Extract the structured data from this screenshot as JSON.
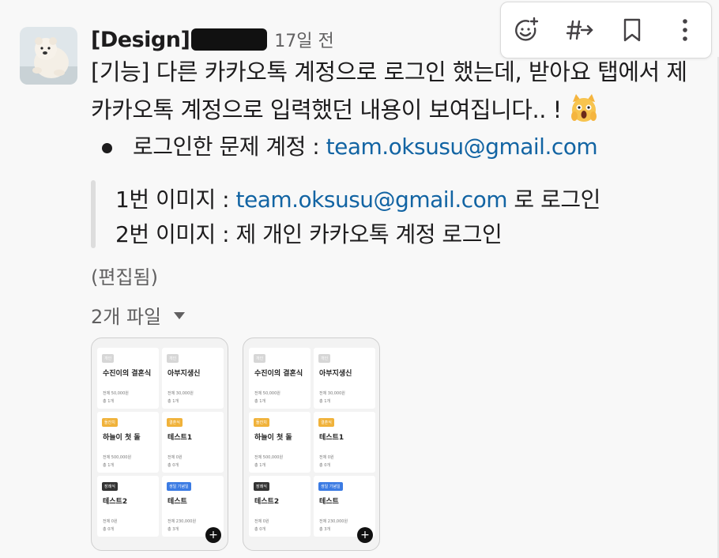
{
  "message": {
    "sender": "[Design]",
    "time": "17일 전",
    "line1": "[기능] 다른 카카오톡 계정으로 로그인 했는데, 받아요 탭에서 제",
    "line2": "카카오톡 계정으로 입력했던 내용이 보여집니다.. !",
    "bullet_label": "로그인한 문제 계정 : ",
    "bullet_email": "team.oksusu@gmail.com",
    "quote1_prefix": "1번 이미지 : ",
    "quote1_email": "team.oksusu@gmail.com",
    "quote1_suffix": " 로 로그인",
    "quote2": "2번 이미지 : 제 개인 카카오톡 계정 로그인",
    "edited": "(편집됨)",
    "files_label": "2개 파일"
  },
  "toolbar": {
    "icons": [
      "add-reaction-icon",
      "reply-in-thread-icon",
      "bookmark-icon",
      "more-options-icon"
    ]
  },
  "thumbnails": [
    {
      "cards": [
        {
          "tag": "개인",
          "tag_color": "#d6d6d6",
          "title": "수진이의 결혼식",
          "meta1": "전체 50,000원",
          "meta2": "총 1개"
        },
        {
          "tag": "개인",
          "tag_color": "#d6d6d6",
          "title": "아부지생신",
          "meta1": "전체 30,000원",
          "meta2": "총 1개"
        },
        {
          "tag": "돌잔치",
          "tag_color": "#f0b23a",
          "title": "하늘이 첫 돌",
          "meta1": "전체 500,000원",
          "meta2": "총 1개"
        },
        {
          "tag": "결혼식",
          "tag_color": "#f0b23a",
          "title": "테스트1",
          "meta1": "전체 0원",
          "meta2": "총 0개"
        },
        {
          "tag": "장례식",
          "tag_color": "#333333",
          "title": "테스트2",
          "meta1": "전체 0원",
          "meta2": "총 0개"
        },
        {
          "tag": "생일 기념일",
          "tag_color": "#3b7be3",
          "title": "테스트",
          "meta1": "전체 230,000원",
          "meta2": "총 3개"
        }
      ],
      "fab": "+"
    },
    {
      "cards": [
        {
          "tag": "개인",
          "tag_color": "#d6d6d6",
          "title": "수진이의 결혼식",
          "meta1": "전체 50,000원",
          "meta2": "총 1개"
        },
        {
          "tag": "개인",
          "tag_color": "#d6d6d6",
          "title": "아부지생신",
          "meta1": "전체 30,000원",
          "meta2": "총 1개"
        },
        {
          "tag": "돌잔치",
          "tag_color": "#f0b23a",
          "title": "하늘이 첫 돌",
          "meta1": "전체 500,000원",
          "meta2": "총 1개"
        },
        {
          "tag": "결혼식",
          "tag_color": "#f0b23a",
          "title": "테스트1",
          "meta1": "전체 0원",
          "meta2": "총 0개"
        },
        {
          "tag": "장례식",
          "tag_color": "#333333",
          "title": "테스트2",
          "meta1": "전체 0원",
          "meta2": "총 0개"
        },
        {
          "tag": "생일 기념일",
          "tag_color": "#3b7be3",
          "title": "테스트",
          "meta1": "전체 230,000원",
          "meta2": "총 3개"
        }
      ],
      "fab": "+"
    }
  ],
  "colors": {
    "link": "#1264a3",
    "muted": "#616061",
    "text": "#1d1c1d"
  }
}
